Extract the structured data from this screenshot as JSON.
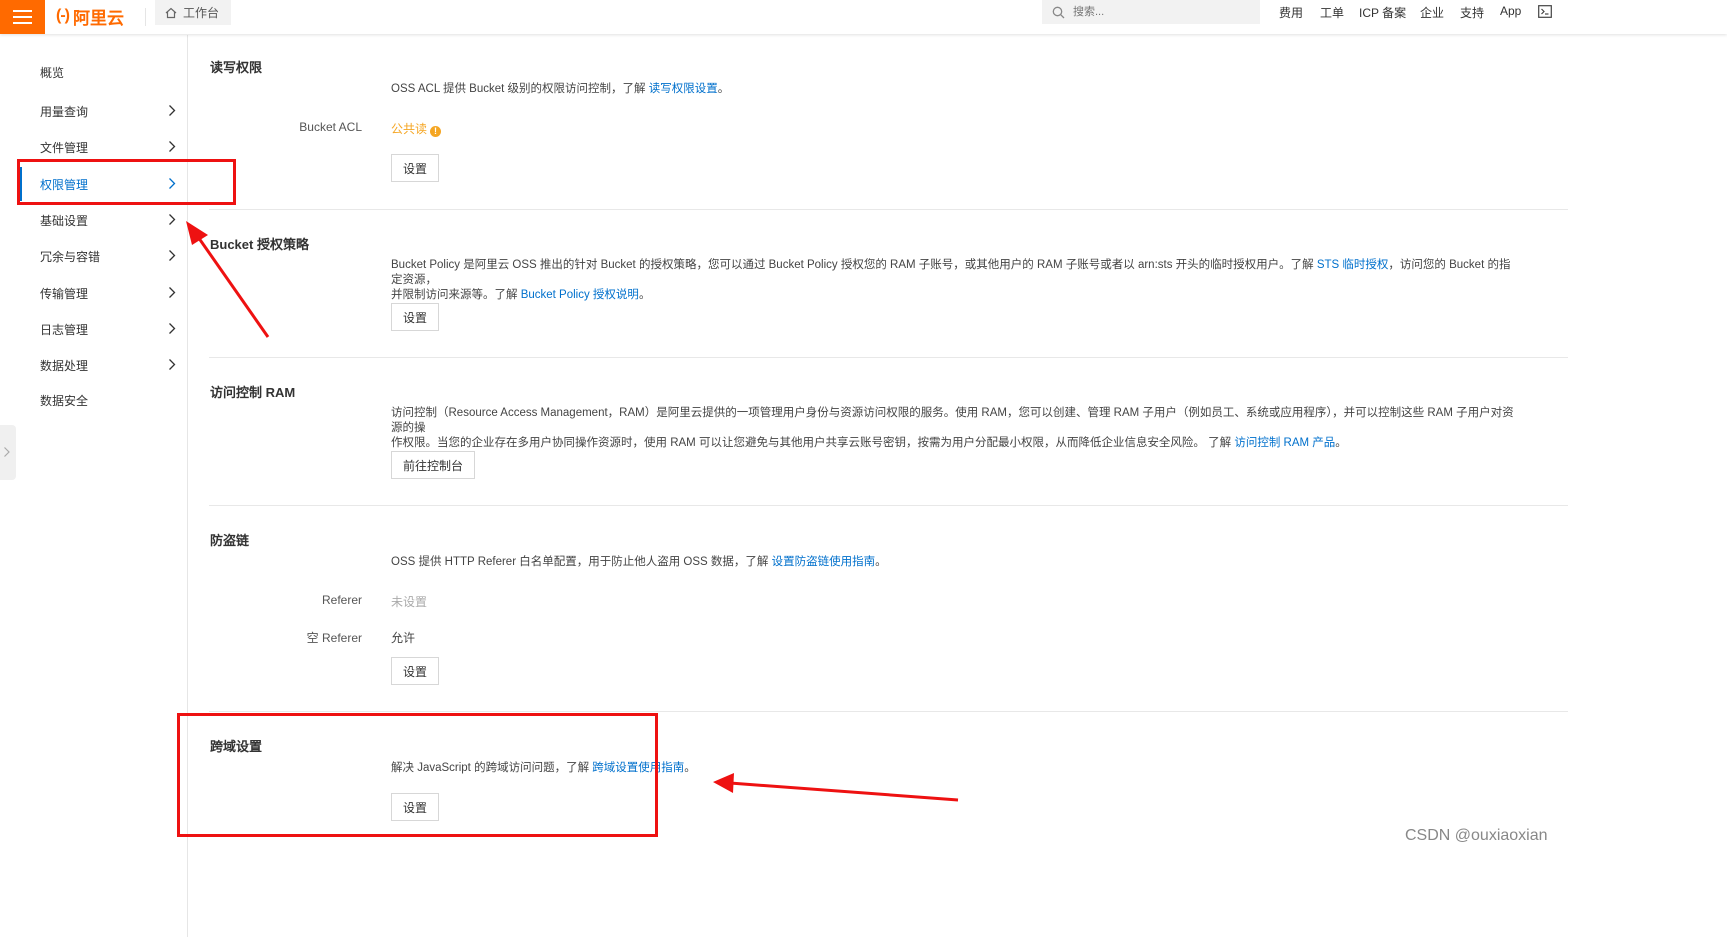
{
  "header": {
    "logo_mark": "(-)",
    "logo_text": "阿里云",
    "workbench_label": "工作台",
    "search_placeholder": "搜索...",
    "nav_items": [
      "费用",
      "工单",
      "ICP 备案",
      "企业",
      "支持",
      "App"
    ],
    "accent_color": "#ff6a00"
  },
  "sidebar": {
    "items": [
      {
        "label": "概览",
        "has_chevron": false
      },
      {
        "label": "用量查询",
        "has_chevron": true
      },
      {
        "label": "文件管理",
        "has_chevron": true
      },
      {
        "label": "权限管理",
        "has_chevron": true,
        "active": true
      },
      {
        "label": "基础设置",
        "has_chevron": true
      },
      {
        "label": "冗余与容错",
        "has_chevron": true
      },
      {
        "label": "传输管理",
        "has_chevron": true
      },
      {
        "label": "日志管理",
        "has_chevron": true
      },
      {
        "label": "数据处理",
        "has_chevron": true
      },
      {
        "label": "数据安全",
        "has_chevron": false
      }
    ],
    "active_color": "#0070cc"
  },
  "sections": {
    "acl": {
      "title": "读写权限",
      "desc_prefix": "OSS ACL 提供 Bucket 级别的权限访问控制，了解 ",
      "desc_link": "读写权限设置",
      "desc_suffix": "。",
      "row_label": "Bucket ACL",
      "row_value": "公共读",
      "warn_mark": "!",
      "value_color": "#f5a623",
      "button": "设置"
    },
    "policy": {
      "title": "Bucket 授权策略",
      "desc_line1_prefix": "Bucket Policy 是阿里云 OSS 推出的针对 Bucket 的授权策略，您可以通过 Bucket Policy 授权您的 RAM 子账号，或其他用户的 RAM 子账号或者以 arn:sts 开头的临时授权用户。了解 ",
      "desc_line1_link": "STS 临时授权",
      "desc_line1_suffix": "，访问您的 Bucket 的指定资源，",
      "desc_line2_prefix": "并限制访问来源等。了解 ",
      "desc_line2_link": "Bucket Policy 授权说明",
      "desc_line2_suffix": "。",
      "button": "设置"
    },
    "ram": {
      "title": "访问控制 RAM",
      "desc_line1": "访问控制（Resource Access Management，RAM）是阿里云提供的一项管理用户身份与资源访问权限的服务。使用 RAM，您可以创建、管理 RAM 子用户（例如员工、系统或应用程序），并可以控制这些 RAM 子用户对资源的操",
      "desc_line2_prefix": "作权限。当您的企业存在多用户协同操作资源时，使用 RAM 可以让您避免与其他用户共享云账号密钥，按需为用户分配最小权限，从而降低企业信息安全风险。 了解 ",
      "desc_line2_link": "访问控制 RAM 产品",
      "desc_line2_suffix": "。",
      "button": "前往控制台"
    },
    "referer": {
      "title": "防盗链",
      "desc_prefix": "OSS 提供 HTTP Referer 白名单配置，用于防止他人盗用 OSS 数据，了解 ",
      "desc_link": "设置防盗链使用指南",
      "desc_suffix": "。",
      "referer_label": "Referer",
      "referer_value": "未设置",
      "empty_referer_label": "空 Referer",
      "empty_referer_value": "允许",
      "button": "设置"
    },
    "cors": {
      "title": "跨域设置",
      "desc_prefix": "解决 JavaScript 的跨域访问问题，了解 ",
      "desc_link": "跨域设置使用指南",
      "desc_suffix": "。",
      "button": "设置"
    }
  },
  "annotations": {
    "color": "#ee1111"
  },
  "watermark": "CSDN @ouxiaoxian"
}
